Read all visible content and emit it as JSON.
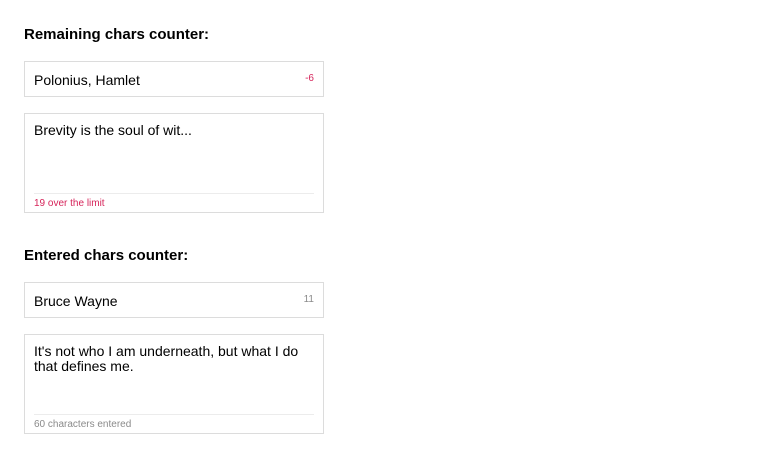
{
  "colors": {
    "over_limit": "#d6245a",
    "muted": "#8a8a8a",
    "border": "#dcdcdc"
  },
  "remaining": {
    "title": "Remaining chars counter:",
    "input": {
      "value": "Polonius, Hamlet",
      "counter": "-6"
    },
    "textarea": {
      "value": "Brevity is the soul of wit...",
      "status": "19 over the limit"
    }
  },
  "entered": {
    "title": "Entered chars counter:",
    "input": {
      "value": "Bruce Wayne",
      "counter": "11"
    },
    "textarea": {
      "value": "It's not who I am underneath, but what I do that defines me.",
      "status": "60 characters entered"
    }
  }
}
